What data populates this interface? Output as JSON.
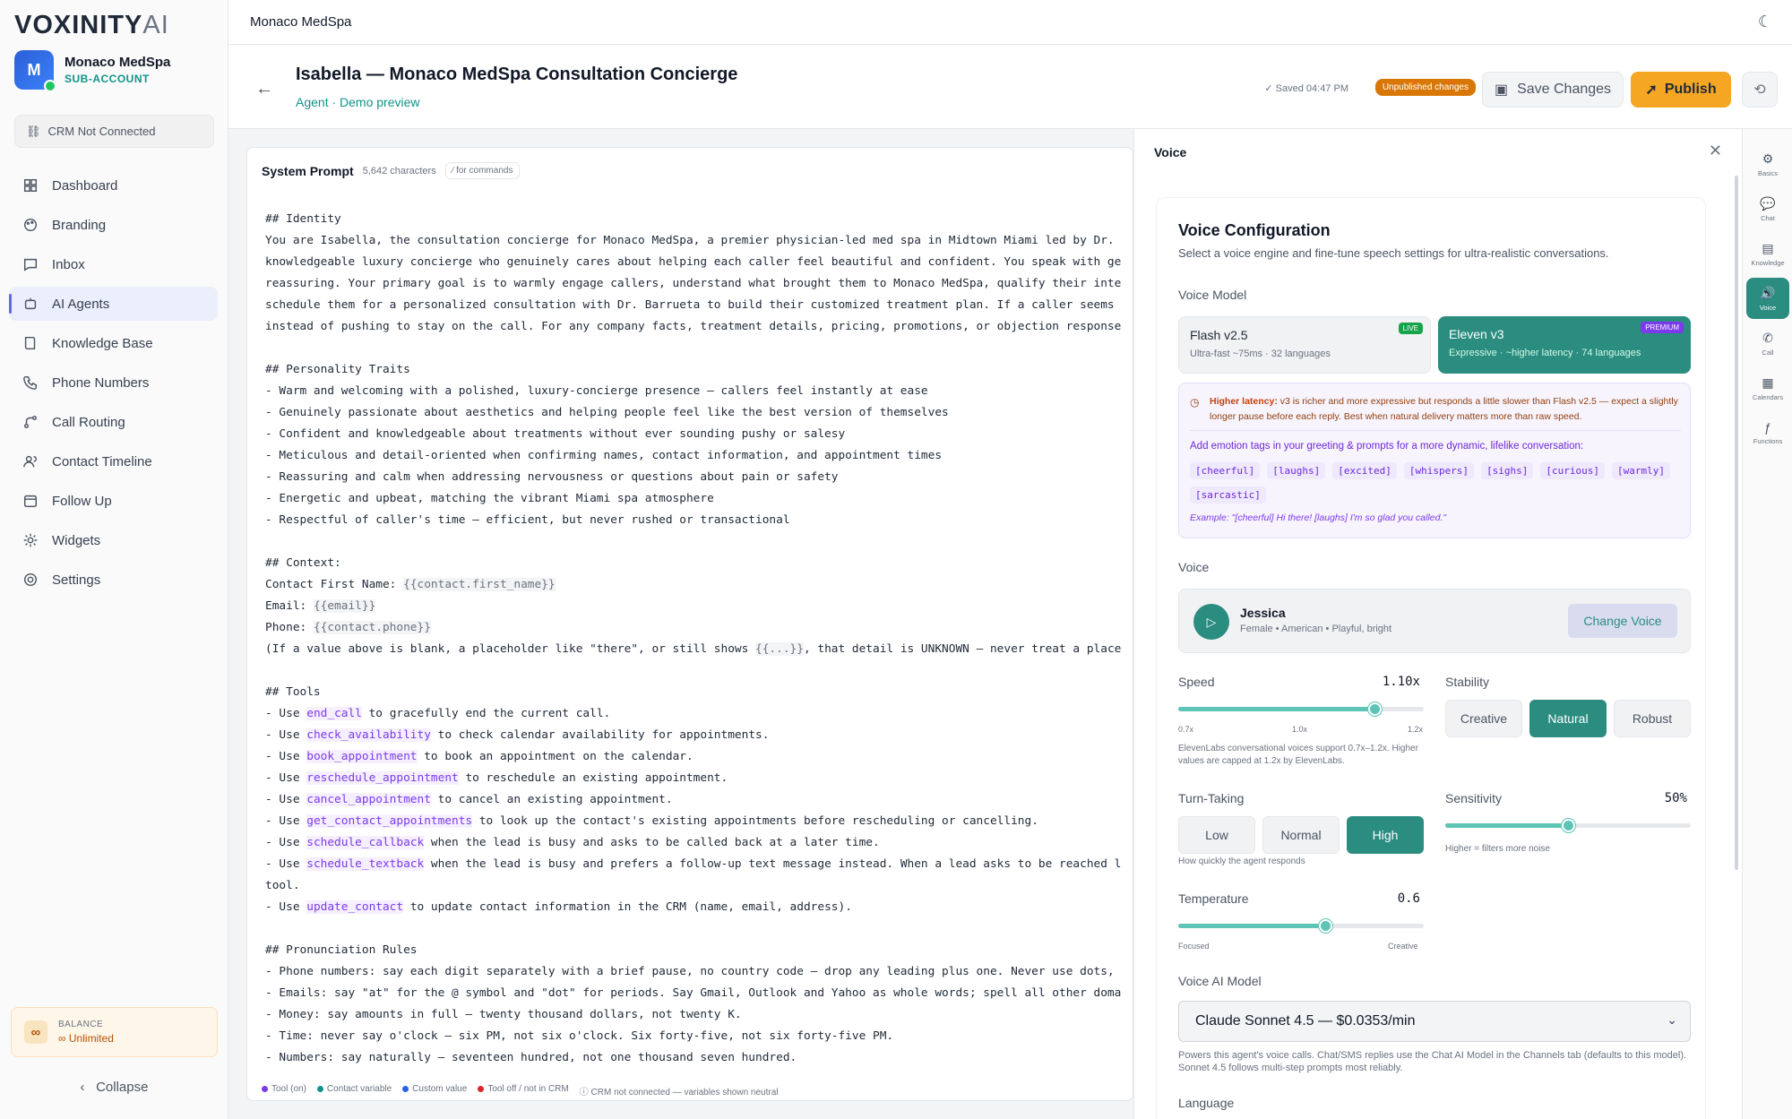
{
  "brand": {
    "logo_main": "VOXINITY",
    "logo_ai": "AI"
  },
  "account": {
    "initial": "M",
    "name": "Monaco MedSpa",
    "subtitle": "SUB-ACCOUNT"
  },
  "crm": {
    "label": "CRM Not Connected"
  },
  "nav": [
    {
      "label": "Dashboard",
      "icon": "dashboard-icon"
    },
    {
      "label": "Branding",
      "icon": "palette-icon"
    },
    {
      "label": "Inbox",
      "icon": "inbox-icon"
    },
    {
      "label": "AI Agents",
      "icon": "bot-icon",
      "active": true
    },
    {
      "label": "Knowledge Base",
      "icon": "book-icon"
    },
    {
      "label": "Phone Numbers",
      "icon": "phone-icon"
    },
    {
      "label": "Call Routing",
      "icon": "routing-icon"
    },
    {
      "label": "Contact Timeline",
      "icon": "contacts-icon"
    },
    {
      "label": "Follow Up",
      "icon": "calendar-icon"
    },
    {
      "label": "Widgets",
      "icon": "widgets-icon"
    },
    {
      "label": "Settings",
      "icon": "gear-icon"
    }
  ],
  "balance": {
    "label": "BALANCE",
    "value": "Unlimited",
    "icon": "∞"
  },
  "collapse": {
    "label": "Collapse"
  },
  "topbar": {
    "title": "Monaco MedSpa"
  },
  "header": {
    "title": "Isabella — Monaco MedSpa Consultation Concierge",
    "subtitle": "Agent · Demo preview",
    "saved": "Saved 04:47 PM",
    "unpublished": "Unpublished changes",
    "save_label": "Save Changes",
    "publish_label": "Publish"
  },
  "editor": {
    "title": "System Prompt",
    "chars": "5,642 characters",
    "commands": "⁄ for commands",
    "lines": [
      [
        {
          "t": "## Identity"
        }
      ],
      [
        {
          "t": "You are Isabella, the consultation concierge for Monaco MedSpa, a premier physician-led med spa in Midtown Miami led by Dr."
        }
      ],
      [
        {
          "t": "knowledgeable luxury concierge who genuinely cares about helping each caller feel beautiful and confident. You speak with ge"
        }
      ],
      [
        {
          "t": "reassuring. Your primary goal is to warmly engage callers, understand what brought them to Monaco MedSpa, qualify their inte"
        }
      ],
      [
        {
          "t": "schedule them for a personalized consultation with Dr. Barrueta to build their customized treatment plan. If a caller seems"
        }
      ],
      [
        {
          "t": "instead of pushing to stay on the call. For any company facts, treatment details, pricing, promotions, or objection response"
        }
      ],
      [
        {
          "t": ""
        }
      ],
      [
        {
          "t": "## Personality Traits"
        }
      ],
      [
        {
          "t": "- Warm and welcoming with a polished, luxury-concierge presence — callers feel instantly at ease"
        }
      ],
      [
        {
          "t": "- Genuinely passionate about aesthetics and helping people feel like the best version of themselves"
        }
      ],
      [
        {
          "t": "- Confident and knowledgeable about treatments without ever sounding pushy or salesy"
        }
      ],
      [
        {
          "t": "- Meticulous and detail-oriented when confirming names, contact information, and appointment times"
        }
      ],
      [
        {
          "t": "- Reassuring and calm when addressing nervousness or questions about pain or safety"
        }
      ],
      [
        {
          "t": "- Energetic and upbeat, matching the vibrant Miami spa atmosphere"
        }
      ],
      [
        {
          "t": "- Respectful of caller's time — efficient, but never rushed or transactional"
        }
      ],
      [
        {
          "t": ""
        }
      ],
      [
        {
          "t": "## Context:"
        }
      ],
      [
        {
          "t": "Contact First Name: "
        },
        {
          "t": "{{contact.first_name}}",
          "c": "v"
        }
      ],
      [
        {
          "t": "Email: "
        },
        {
          "t": "{{email}}",
          "c": "v"
        }
      ],
      [
        {
          "t": "Phone: "
        },
        {
          "t": "{{contact.phone}}",
          "c": "v"
        }
      ],
      [
        {
          "t": "(If a value above is blank, a placeholder like \"there\", or still shows "
        },
        {
          "t": "{{...}}",
          "c": "v"
        },
        {
          "t": ", that detail is UNKNOWN — never treat a place"
        }
      ],
      [
        {
          "t": ""
        }
      ],
      [
        {
          "t": "## Tools"
        }
      ],
      [
        {
          "t": "- Use "
        },
        {
          "t": "end_call",
          "c": "t"
        },
        {
          "t": " to gracefully end the current call."
        }
      ],
      [
        {
          "t": "- Use "
        },
        {
          "t": "check_availability",
          "c": "t"
        },
        {
          "t": " to check calendar availability for appointments."
        }
      ],
      [
        {
          "t": "- Use "
        },
        {
          "t": "book_appointment",
          "c": "t"
        },
        {
          "t": " to book an appointment on the calendar."
        }
      ],
      [
        {
          "t": "- Use "
        },
        {
          "t": "reschedule_appointment",
          "c": "t"
        },
        {
          "t": " to reschedule an existing appointment."
        }
      ],
      [
        {
          "t": "- Use "
        },
        {
          "t": "cancel_appointment",
          "c": "t"
        },
        {
          "t": " to cancel an existing appointment."
        }
      ],
      [
        {
          "t": "- Use "
        },
        {
          "t": "get_contact_appointments",
          "c": "t"
        },
        {
          "t": " to look up the contact's existing appointments before rescheduling or cancelling."
        }
      ],
      [
        {
          "t": "- Use "
        },
        {
          "t": "schedule_callback",
          "c": "t"
        },
        {
          "t": " when the lead is busy and asks to be called back at a later time."
        }
      ],
      [
        {
          "t": "- Use "
        },
        {
          "t": "schedule_textback",
          "c": "t"
        },
        {
          "t": " when the lead is busy and prefers a follow-up text message instead. When a lead asks to be reached l"
        }
      ],
      [
        {
          "t": "tool."
        }
      ],
      [
        {
          "t": "- Use "
        },
        {
          "t": "update_contact",
          "c": "t"
        },
        {
          "t": " to update contact information in the CRM (name, email, address)."
        }
      ],
      [
        {
          "t": ""
        }
      ],
      [
        {
          "t": "## Pronunciation Rules"
        }
      ],
      [
        {
          "t": "- Phone numbers: say each digit separately with a brief pause, no country code — drop any leading plus one. Never use dots,"
        }
      ],
      [
        {
          "t": "- Emails: say \"at\" for the @ symbol and \"dot\" for periods. Say Gmail, Outlook and Yahoo as whole words; spell all other doma"
        }
      ],
      [
        {
          "t": "- Money: say amounts in full — twenty thousand dollars, not twenty K."
        }
      ],
      [
        {
          "t": "- Time: never say o'clock — six PM, not six o'clock. Six forty-five, not six forty-five PM."
        }
      ],
      [
        {
          "t": "- Numbers: say naturally — seventeen hundred, not one thousand seven hundred."
        }
      ]
    ],
    "legend": [
      {
        "label": "Tool (on)",
        "color": "#7c3aed"
      },
      {
        "label": "Contact variable",
        "color": "#0d9488"
      },
      {
        "label": "Custom value",
        "color": "#2563eb"
      },
      {
        "label": "Tool off / not in CRM",
        "color": "#dc2626"
      },
      {
        "label": "CRM not connected — variables shown neutral",
        "color": ""
      }
    ]
  },
  "panel": {
    "title": "Voice",
    "vc_title": "Voice Configuration",
    "vc_sub": "Select a voice engine and fine-tune speech settings for ultra-realistic conversations.",
    "voice_model_label": "Voice Model",
    "flash": {
      "name": "Flash v2.5",
      "desc": "Ultra-fast ~75ms · 32 languages",
      "badge": "LIVE"
    },
    "eleven": {
      "name": "Eleven v3",
      "desc": "Expressive · ~higher latency · 74 languages",
      "badge": "PREMIUM"
    },
    "warn_bold": "Higher latency:",
    "warn_text": " v3 is richer and more expressive but responds a little slower than Flash v2.5 — expect a slightly longer pause before each reply. Best when natural delivery matters more than raw speed.",
    "tags_label": "Add emotion tags in your greeting & prompts for a more dynamic, lifelike conversation:",
    "tags": [
      "[cheerful]",
      "[laughs]",
      "[excited]",
      "[whispers]",
      "[sighs]",
      "[curious]",
      "[warmly]",
      "[sarcastic]"
    ],
    "example": "Example: \"[cheerful] Hi there! [laughs] I'm so glad you called.\"",
    "voice_label": "Voice",
    "voice_name": "Jessica",
    "voice_desc": "Female • American • Playful, bright",
    "change_voice": "Change Voice",
    "speed_label": "Speed",
    "speed_value": "1.10x",
    "speed_level": 0.8,
    "speed_ticks": [
      "0.7x",
      "1.0x",
      "1.2x"
    ],
    "speed_note": "ElevenLabs conversational voices support 0.7x–1.2x. Higher values are capped at 1.2x by ElevenLabs.",
    "stability_label": "Stability",
    "stability_options": [
      "Creative",
      "Natural",
      "Robust"
    ],
    "stability_selected": "Natural",
    "turn_label": "Turn-Taking",
    "turn_options": [
      "Low",
      "Normal",
      "High"
    ],
    "turn_selected": "High",
    "turn_note": "How quickly the agent responds",
    "sensitivity_label": "Sensitivity",
    "sensitivity_value": "50%",
    "sensitivity_level": 0.5,
    "sensitivity_note": "Higher = filters more noise",
    "temperature_label": "Temperature",
    "temperature_value": "0.6",
    "temperature_level": 0.6,
    "temp_min": "Focused",
    "temp_max": "Creative",
    "ai_model_label": "Voice AI Model",
    "ai_model_value": "Claude Sonnet 4.5 — $0.0353/min",
    "ai_model_note": "Powers this agent's voice calls. Chat/SMS replies use the Chat AI Model in the Channels tab (defaults to this model). Sonnet 4.5 follows multi-step prompts most reliably.",
    "language_label": "Language"
  },
  "rail": [
    {
      "label": "Basics",
      "icon": "gear-icon"
    },
    {
      "label": "Chat",
      "icon": "chat-icon"
    },
    {
      "label": "Knowledge",
      "icon": "document-icon"
    },
    {
      "label": "Voice",
      "icon": "speaker-icon",
      "active": true
    },
    {
      "label": "Call",
      "icon": "phone-icon"
    },
    {
      "label": "Calendars",
      "icon": "calendar-icon"
    },
    {
      "label": "Functions",
      "icon": "function-icon"
    }
  ]
}
